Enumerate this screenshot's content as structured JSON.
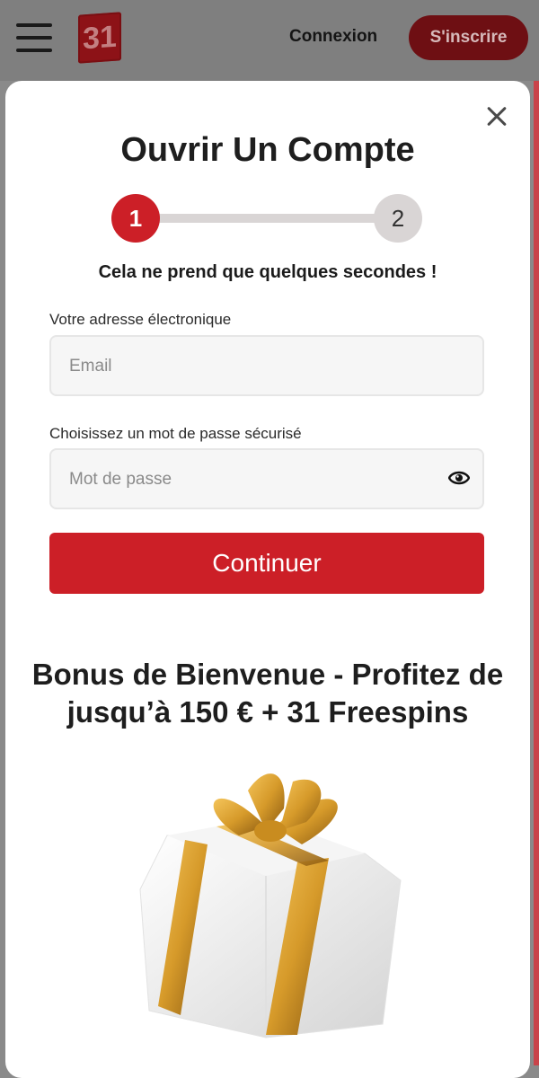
{
  "header": {
    "logo_text": "31",
    "login_label": "Connexion",
    "signup_label": "S'inscrire"
  },
  "modal": {
    "title": "Ouvrir Un Compte",
    "steps": [
      "1",
      "2"
    ],
    "subtitle": "Cela ne prend que quelques secondes !",
    "email_label": "Votre adresse électronique",
    "email_placeholder": "Email",
    "password_label": "Choisissez un mot de passe sécurisé",
    "password_placeholder": "Mot de passe",
    "continue_label": "Continuer",
    "bonus_title": "Bonus de Bienvenue - Profitez de jusqu’à 150 € + 31 Freespins"
  },
  "colors": {
    "brand_red": "#cc1f27",
    "step_inactive": "#d9d5d5"
  },
  "icons": [
    "hamburger-icon",
    "close-icon",
    "eye-icon",
    "gift-image"
  ]
}
